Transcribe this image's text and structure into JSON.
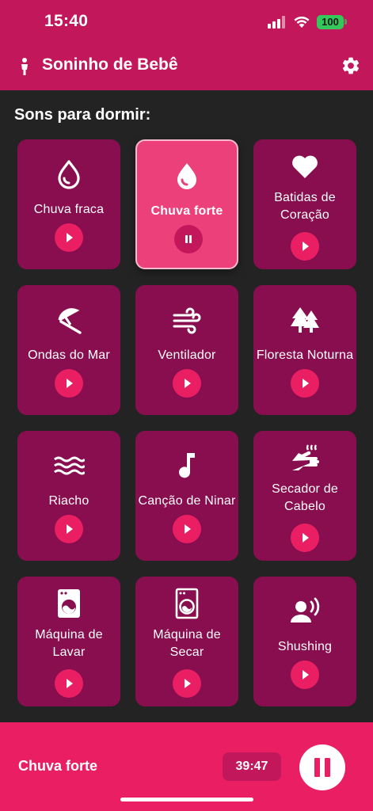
{
  "status": {
    "time": "15:40",
    "battery": "100"
  },
  "appbar": {
    "title": "Soninho de Bebê",
    "leading_icon": "baby-icon",
    "settings_icon": "gear-icon"
  },
  "section_title": "Sons para dormir:",
  "sounds": [
    {
      "label": "Chuva fraca",
      "icon": "water-drop-outline-icon",
      "state": "play"
    },
    {
      "label": "Chuva forte",
      "icon": "water-drop-filled-icon",
      "state": "pause",
      "active": true
    },
    {
      "label": "Batidas de Coração",
      "icon": "heart-icon",
      "state": "play"
    },
    {
      "label": "Ondas do Mar",
      "icon": "beach-umbrella-icon",
      "state": "play"
    },
    {
      "label": "Ventilador",
      "icon": "wind-icon",
      "state": "play"
    },
    {
      "label": "Floresta Noturna",
      "icon": "forest-icon",
      "state": "play"
    },
    {
      "label": "Riacho",
      "icon": "waves-icon",
      "state": "play"
    },
    {
      "label": "Canção de Ninar",
      "icon": "music-note-icon",
      "state": "play"
    },
    {
      "label": "Secador de Cabelo",
      "icon": "dryer-hand-icon",
      "state": "play"
    },
    {
      "label": "Máquina de Lavar",
      "icon": "washing-machine-icon",
      "state": "play"
    },
    {
      "label": "Máquina de Secar",
      "icon": "dryer-machine-icon",
      "state": "play"
    },
    {
      "label": "Shushing",
      "icon": "person-voice-icon",
      "state": "play"
    }
  ],
  "player": {
    "title": "Chuva forte",
    "timer": "39:47",
    "control_icon": "pause-icon"
  },
  "colors": {
    "appbar": "#c2185b",
    "card": "#880e4f",
    "card_active": "#ec407a",
    "accent": "#e91e63",
    "background": "#232323"
  }
}
